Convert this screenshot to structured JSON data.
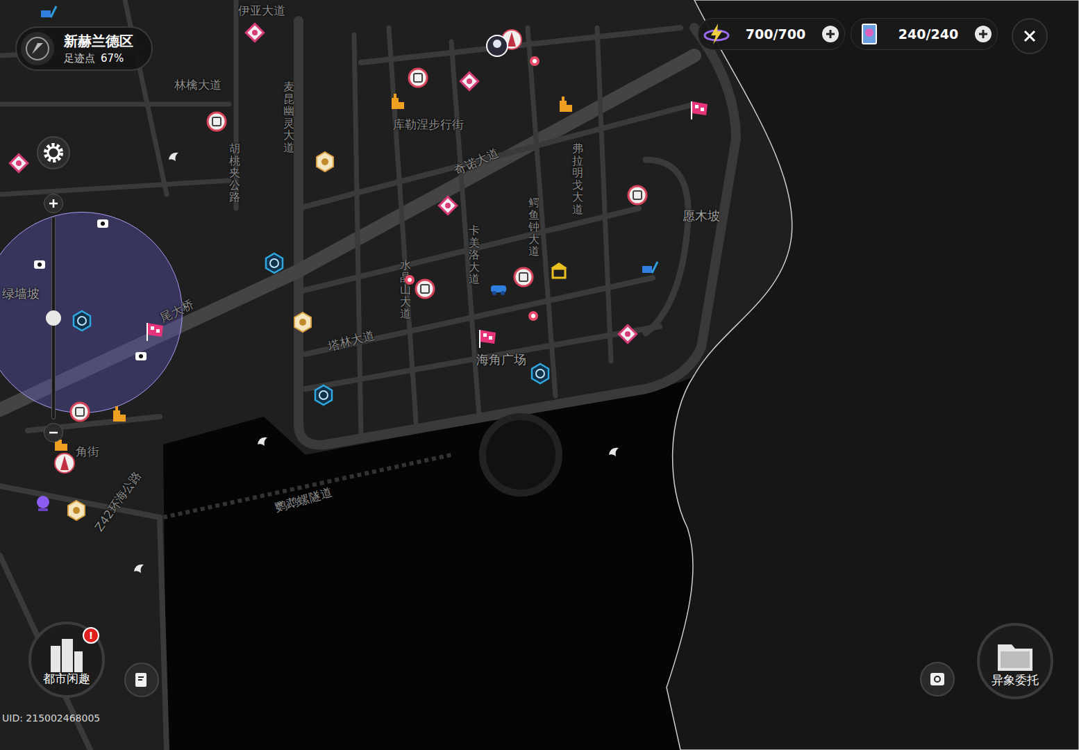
{
  "location": {
    "district": "新赫兰德区",
    "progress_label": "足迹点",
    "progress": "67%"
  },
  "resources": [
    {
      "value": "700/700"
    },
    {
      "value": "240/240"
    }
  ],
  "zoom": {
    "level": 0.5
  },
  "labels": [
    {
      "text": "伊亚大道",
      "kind": "flat"
    },
    {
      "text": "林檎大道",
      "kind": "flat"
    },
    {
      "text": "麦昆幽灵大道",
      "kind": "vertical"
    },
    {
      "text": "胡桃夹公路",
      "kind": "vertical"
    },
    {
      "text": "库勒涅步行街",
      "kind": "flat"
    },
    {
      "text": "奇诺大道",
      "kind": "flat"
    },
    {
      "text": "弗拉明戈大道",
      "kind": "vertical"
    },
    {
      "text": "鳄鱼钟大道",
      "kind": "vertical"
    },
    {
      "text": "卡美洛大道",
      "kind": "vertical"
    },
    {
      "text": "水晶山大道",
      "kind": "vertical"
    },
    {
      "text": "愿木坡",
      "kind": "place"
    },
    {
      "text": "绿墙坡",
      "kind": "place"
    },
    {
      "text": "尾大桥",
      "kind": "flat"
    },
    {
      "text": "塔林大道",
      "kind": "flat"
    },
    {
      "text": "海角广场",
      "kind": "place"
    },
    {
      "text": "角街",
      "kind": "flat"
    },
    {
      "text": "鹦鹉螺隧道",
      "kind": "flat"
    },
    {
      "text": "Z42环海公路",
      "kind": "flat"
    }
  ],
  "buttons": [
    {
      "label": "都市闲趣",
      "alert": "!"
    },
    {
      "label": "异象委托",
      "alert": ""
    }
  ],
  "uid": "UID: 215002468005"
}
